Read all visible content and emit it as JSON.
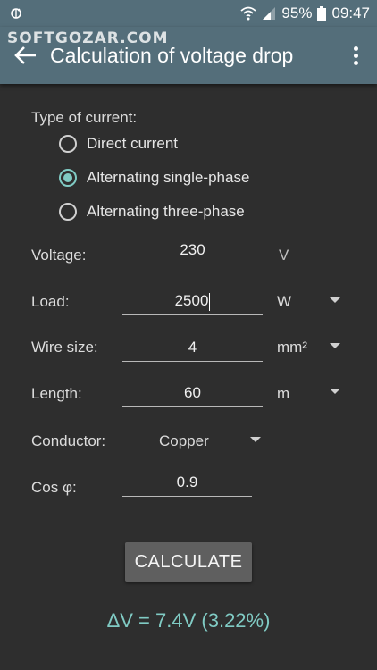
{
  "status": {
    "battery": "95%",
    "time": "09:47"
  },
  "watermark": "SOFTGOZAR.COM",
  "appbar": {
    "title": "Calculation of voltage drop"
  },
  "current": {
    "label": "Type of current:",
    "options": [
      {
        "label": "Direct current",
        "checked": false
      },
      {
        "label": "Alternating single-phase",
        "checked": true
      },
      {
        "label": "Alternating three-phase",
        "checked": false
      }
    ]
  },
  "fields": {
    "voltage": {
      "label": "Voltage:",
      "value": "230",
      "unit": "V"
    },
    "load": {
      "label": "Load:",
      "value": "2500",
      "unit": "W"
    },
    "wire_size": {
      "label": "Wire size:",
      "value": "4",
      "unit": "mm²"
    },
    "length": {
      "label": "Length:",
      "value": "60",
      "unit": "m"
    },
    "conductor": {
      "label": "Conductor:",
      "value": "Copper"
    },
    "cos_phi": {
      "label": "Cos φ:",
      "value": "0.9"
    }
  },
  "button": {
    "calculate": "CALCULATE"
  },
  "result": {
    "text": "ΔV = 7.4V  (3.22%)"
  },
  "colors": {
    "appbar": "#546e7a",
    "accent": "#80cbc4",
    "background": "#2e2e2e"
  }
}
